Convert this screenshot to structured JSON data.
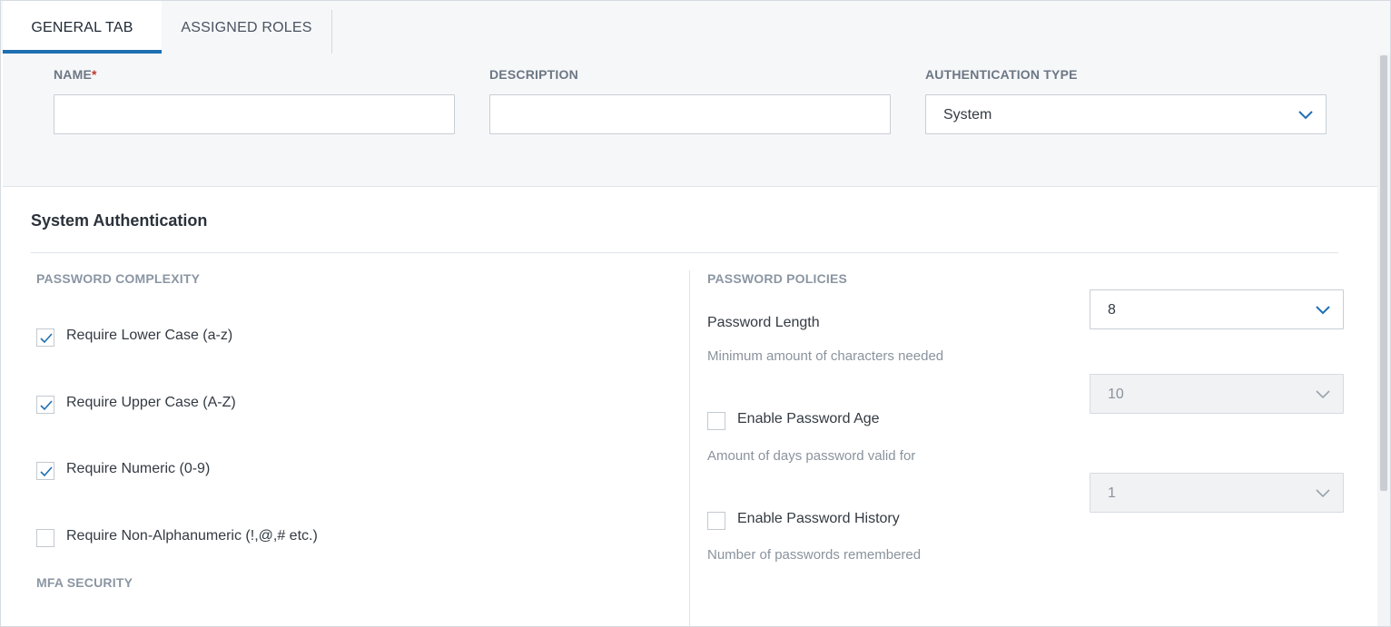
{
  "tabs": [
    {
      "label": "GENERAL TAB",
      "active": true
    },
    {
      "label": "ASSIGNED ROLES",
      "active": false
    }
  ],
  "form": {
    "name": {
      "label": "NAME",
      "required_mark": "*",
      "value": ""
    },
    "description": {
      "label": "DESCRIPTION",
      "value": ""
    },
    "auth_type": {
      "label": "AUTHENTICATION TYPE",
      "value": "System"
    }
  },
  "system_auth": {
    "title": "System Authentication",
    "complexity": {
      "label": "PASSWORD COMPLEXITY",
      "items": [
        {
          "label": "Require Lower Case (a-z)",
          "checked": true
        },
        {
          "label": "Require Upper Case (A-Z)",
          "checked": true
        },
        {
          "label": "Require Numeric (0-9)",
          "checked": true
        },
        {
          "label": "Require Non-Alphanumeric (!,@,# etc.)",
          "checked": false
        }
      ]
    },
    "mfa_label": "MFA SECURITY",
    "policies": {
      "label": "PASSWORD POLICIES",
      "length": {
        "label": "Password Length",
        "helper": "Minimum amount of characters needed",
        "value": "8"
      },
      "age": {
        "label": "Enable Password Age",
        "checked": false,
        "helper": "Amount of days password valid for",
        "value": "10",
        "disabled": true
      },
      "history": {
        "label": "Enable Password History",
        "checked": false,
        "helper": "Number of passwords remembered",
        "value": "1",
        "disabled": true
      }
    }
  },
  "colors": {
    "accent": "#1f6fb3",
    "required": "#c0392b",
    "check": "#1f6fb3"
  },
  "icons": {
    "dropdown": "chevron-down-icon",
    "check": "check-icon"
  }
}
